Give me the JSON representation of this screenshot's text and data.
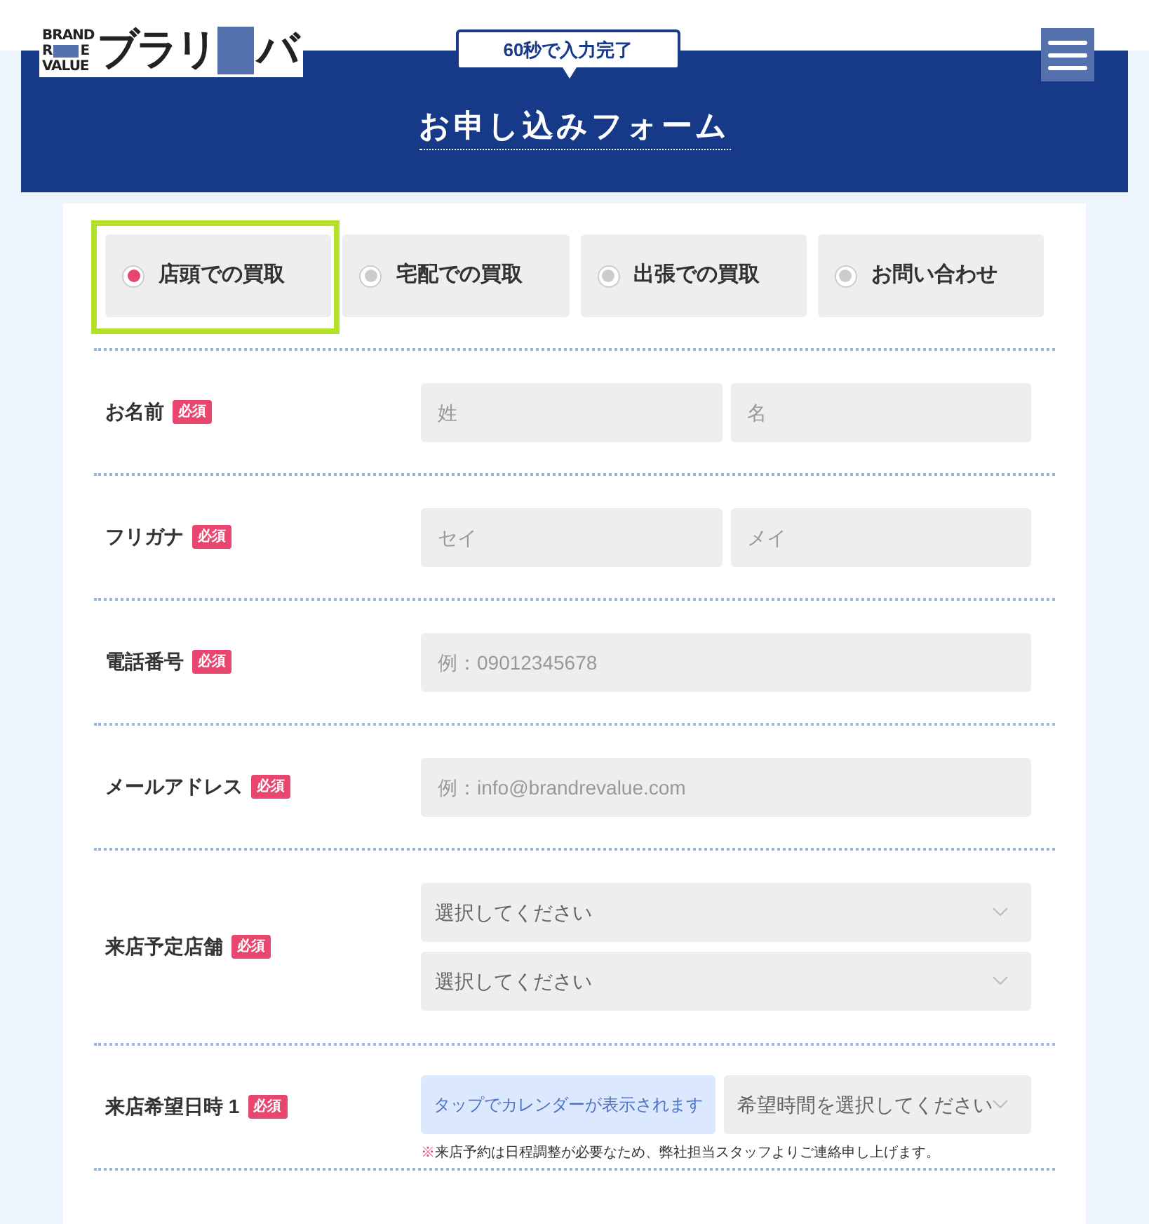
{
  "header": {
    "logo": {
      "wordmark": [
        "BRAND",
        "R",
        "E",
        "VALUE"
      ],
      "katakana": "ブラリ",
      "katakana_end": "バ"
    },
    "badge": "60秒で入力完了",
    "title": "お申し込みフォーム"
  },
  "purposes": [
    {
      "label": "店頭での買取",
      "selected": true,
      "highlighted": true
    },
    {
      "label": "宅配での買取",
      "selected": false,
      "highlighted": false
    },
    {
      "label": "出張での買取",
      "selected": false,
      "highlighted": false
    },
    {
      "label": "お問い合わせ",
      "selected": false,
      "highlighted": false
    }
  ],
  "fields": [
    {
      "label": "お名前",
      "required_badge": "必須",
      "inputs": [
        {
          "kind": "text",
          "placeholder": "姓"
        },
        {
          "kind": "text",
          "placeholder": "名"
        }
      ]
    },
    {
      "label": "フリガナ",
      "required_badge": "必須",
      "inputs": [
        {
          "kind": "text",
          "placeholder": "セイ"
        },
        {
          "kind": "text",
          "placeholder": "メイ"
        }
      ]
    },
    {
      "label": "電話番号",
      "required_badge": "必須",
      "inputs": [
        {
          "kind": "text",
          "placeholder": "例：09012345678"
        }
      ]
    },
    {
      "label": "メールアドレス",
      "required_badge": "必須",
      "inputs": [
        {
          "kind": "text",
          "placeholder": "例：info@brandrevalue.com"
        }
      ]
    },
    {
      "label": "来店予定店舗",
      "required_badge": "必須",
      "inputs": [
        {
          "kind": "select",
          "value": "選択してください"
        },
        {
          "kind": "select",
          "value": "選択してください"
        }
      ]
    },
    {
      "label": "来店希望日時 1",
      "required_badge": "必須",
      "inputs": [
        {
          "kind": "calendar",
          "value": "タップでカレンダーが表示されます"
        },
        {
          "kind": "select",
          "value": "希望時間を選択してください"
        }
      ],
      "note_mark": "※",
      "note": "来店予約は日程調整が必要なため、弊社担当スタッフよりご連絡申し上げます。"
    }
  ]
}
